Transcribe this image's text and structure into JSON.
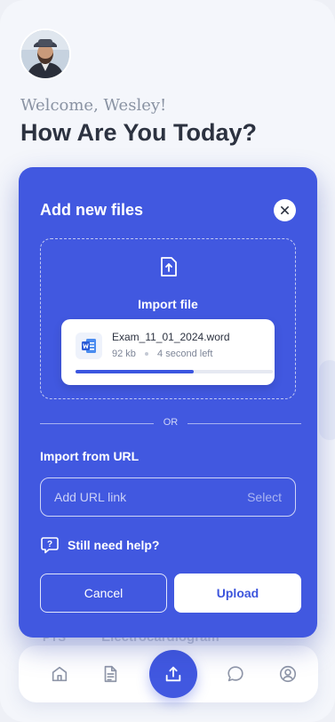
{
  "header": {
    "welcome": "Welcome, Wesley!",
    "headline": "How Are You Today?"
  },
  "background": {
    "record_code": "PYS",
    "record_title": "Electrocardiogram"
  },
  "modal": {
    "title": "Add new files",
    "dropzone": {
      "label": "Import file"
    },
    "file": {
      "name": "Exam_11_01_2024.word",
      "size": "92 kb",
      "time_left": "4 second left",
      "progress": 0.6
    },
    "divider_label": "OR",
    "url": {
      "label": "Import from URL",
      "placeholder": "Add URL link",
      "select_label": "Select"
    },
    "help_text": "Still need help?",
    "cancel_label": "Cancel",
    "upload_label": "Upload"
  },
  "nav": {
    "items": [
      "home-icon",
      "document-icon",
      "upload-icon",
      "chat-icon",
      "profile-icon"
    ]
  },
  "colors": {
    "accent": "#4158E0",
    "background": "#F4F6FB",
    "heading": "#2C3240",
    "muted": "#8A93A3"
  }
}
